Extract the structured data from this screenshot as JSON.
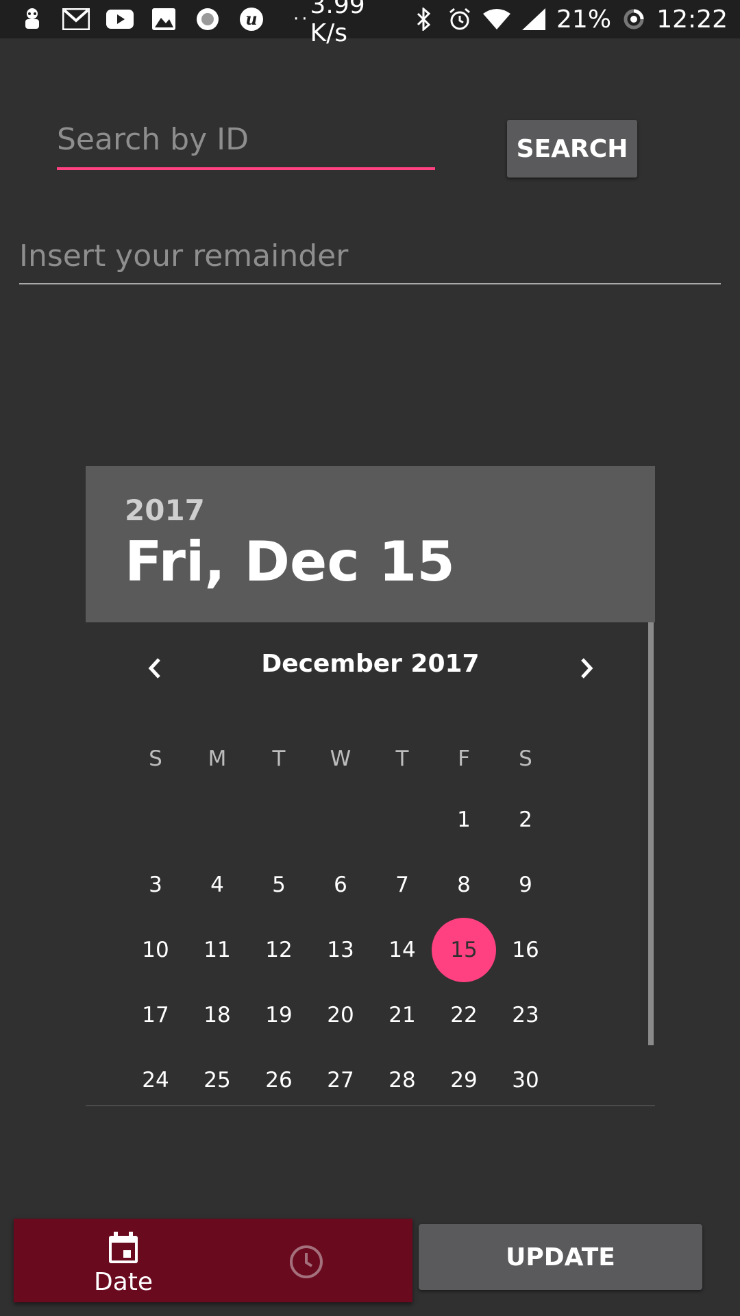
{
  "status_bar": {
    "network_speed": "3.99 K/s",
    "battery": "21%",
    "time": "12:22",
    "dots": "··",
    "icons": [
      "notification-bot-icon",
      "gmail-icon",
      "youtube-icon",
      "gallery-icon",
      "record-icon",
      "u-app-icon",
      "bluetooth-icon",
      "alarm-icon",
      "wifi-icon",
      "signal-icon",
      "battery-ring-icon"
    ]
  },
  "search": {
    "placeholder": "Search by ID",
    "value": "",
    "button_label": "SEARCH"
  },
  "reminder": {
    "placeholder": "Insert your remainder",
    "value": ""
  },
  "date_picker": {
    "year": "2017",
    "selected_date": "Fri, Dec 15",
    "month_title": "December 2017",
    "weekdays": [
      "S",
      "M",
      "T",
      "W",
      "T",
      "F",
      "S"
    ],
    "weeks": [
      [
        "",
        "",
        "",
        "",
        "",
        "1",
        "2"
      ],
      [
        "3",
        "4",
        "5",
        "6",
        "7",
        "8",
        "9"
      ],
      [
        "10",
        "11",
        "12",
        "13",
        "14",
        "15",
        "16"
      ],
      [
        "17",
        "18",
        "19",
        "20",
        "21",
        "22",
        "23"
      ],
      [
        "24",
        "25",
        "26",
        "27",
        "28",
        "29",
        "30"
      ]
    ],
    "selected_day": "15"
  },
  "bottom_bar": {
    "date_tab_label": "Date",
    "update_label": "UPDATE"
  },
  "colors": {
    "accent": "#ff4081",
    "background": "#303030",
    "header": "#5a5a5a",
    "tab_bar": "#6a0a1f"
  }
}
